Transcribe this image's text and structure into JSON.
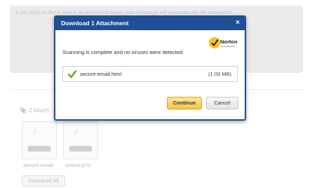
{
  "background": {
    "notice": "If you reply to the e-mail in an internet browser your message will automatically be encrypted.",
    "attachments_label": "2 Attach",
    "files": [
      {
        "name": "secure-email"
      },
      {
        "name": "smime.p7s"
      }
    ],
    "download_all_label": "Download All"
  },
  "dialog": {
    "title": "Download 1 Attachment",
    "close_label": "×",
    "norton": {
      "name": "Norton",
      "sub": "by Symantec"
    },
    "message": "Scanning is complete and no viruses were detected.",
    "file": {
      "name": "secure-email.html",
      "size": "(1.09 MB)"
    },
    "continue_label": "Continue",
    "cancel_label": "Cancel"
  },
  "colors": {
    "dialog_header": "#1f4f95",
    "continue_button": "#f6c446",
    "check_green": "#5aa51e",
    "norton_yellow": "#f6c516"
  },
  "icons": {
    "attachment": "paperclip-icon",
    "scan_result": "checkmark-icon",
    "brand": "norton-check-icon"
  }
}
